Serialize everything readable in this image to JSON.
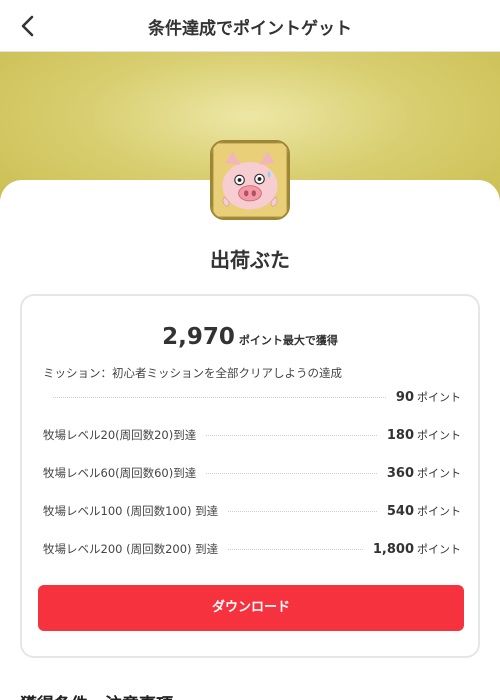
{
  "header": {
    "title": "条件達成でポイントゲット"
  },
  "icons": {
    "back": "chevron-left-icon",
    "app": "pig-app-icon"
  },
  "app": {
    "name": "出荷ぶた"
  },
  "summary": {
    "total_points": "2,970",
    "total_label": "ポイント最大で獲得"
  },
  "mission": {
    "title": "ミッション：初心者ミッションを全部クリアしようの達成"
  },
  "rows": [
    {
      "label": "",
      "points": "90",
      "unit": "ポイント"
    },
    {
      "label": "牧場レベル20(周回数20)到達",
      "points": "180",
      "unit": "ポイント"
    },
    {
      "label": "牧場レベル60(周回数60)到達",
      "points": "360",
      "unit": "ポイント"
    },
    {
      "label": "牧場レベル100 (周回数100) 到達",
      "points": "540",
      "unit": "ポイント"
    },
    {
      "label": "牧場レベル200 (周回数200) 到達",
      "points": "1,800",
      "unit": "ポイント"
    }
  ],
  "download_button": {
    "label": "ダウンロード"
  },
  "section": {
    "title": "獲得条件・注意事項"
  },
  "colors": {
    "accent": "#f6323f",
    "banner": "#d9cf72"
  }
}
